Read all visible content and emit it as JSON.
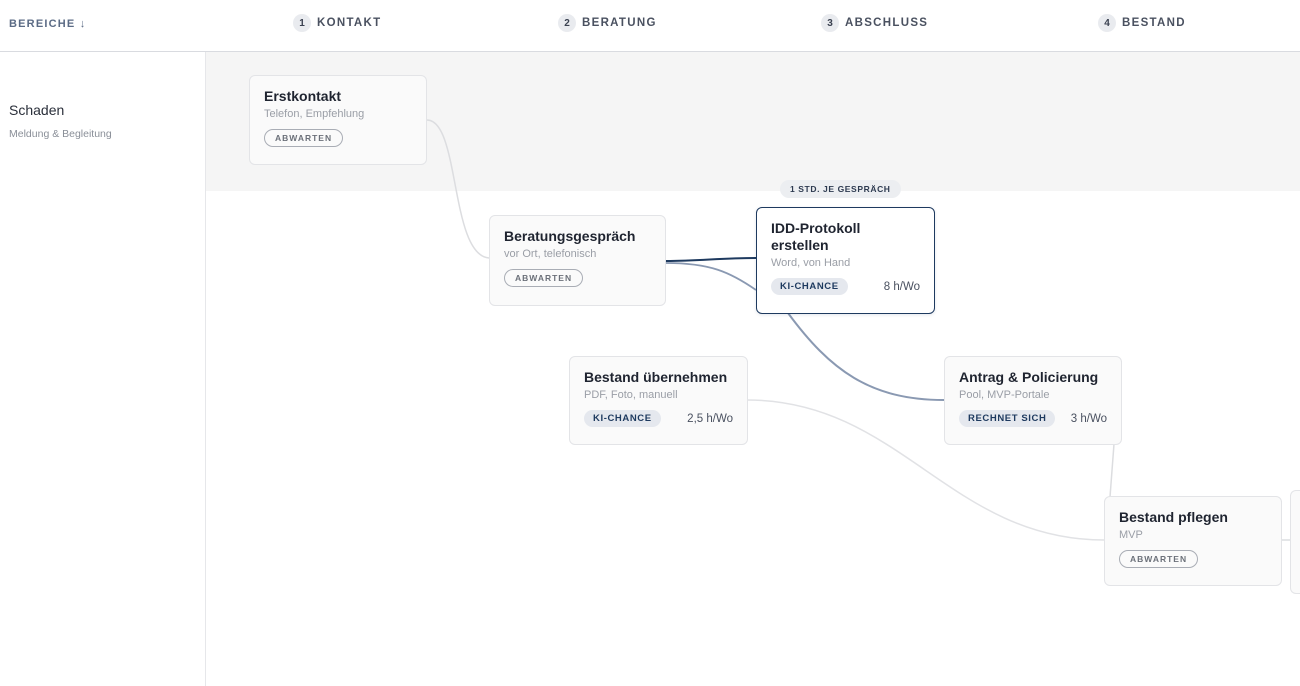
{
  "header": {
    "bereiche_label": "BEREICHE ↓",
    "phases": [
      {
        "num": "1",
        "label": "KONTAKT"
      },
      {
        "num": "2",
        "label": "BERATUNG"
      },
      {
        "num": "3",
        "label": "ABSCHLUSS"
      },
      {
        "num": "4",
        "label": "BESTAND"
      }
    ]
  },
  "sidebar": {
    "title": "Schaden",
    "subtitle": "Meldung & Begleitung"
  },
  "badge": "1 STD. JE GESPRÄCH",
  "cards": {
    "erstkontakt": {
      "title": "Erstkontakt",
      "sub": "Telefon, Empfehlung",
      "pill": "ABWARTEN"
    },
    "beratung": {
      "title": "Beratungsgespräch",
      "sub": "vor Ort, telefonisch",
      "pill": "ABWARTEN"
    },
    "idd": {
      "title": "IDD-Protokoll erstellen",
      "sub": "Word, von Hand",
      "pill": "KI-CHANCE",
      "hours": "8 h/Wo"
    },
    "bestand_uebernehmen": {
      "title": "Bestand übernehmen",
      "sub": "PDF, Foto, manuell",
      "pill": "KI-CHANCE",
      "hours": "2,5 h/Wo"
    },
    "antrag": {
      "title": "Antrag & Policierung",
      "sub": "Pool, MVP-Portale",
      "pill": "RECHNET SICH",
      "hours": "3 h/Wo"
    },
    "bestand_pflegen": {
      "title": "Bestand pflegen",
      "sub": "MVP",
      "pill": "ABWARTEN"
    }
  },
  "colors": {
    "accent": "#1e3a5f",
    "highlight_link": "#8a99b2",
    "muted_link": "#dcdde0",
    "band": "#f5f5f5"
  }
}
